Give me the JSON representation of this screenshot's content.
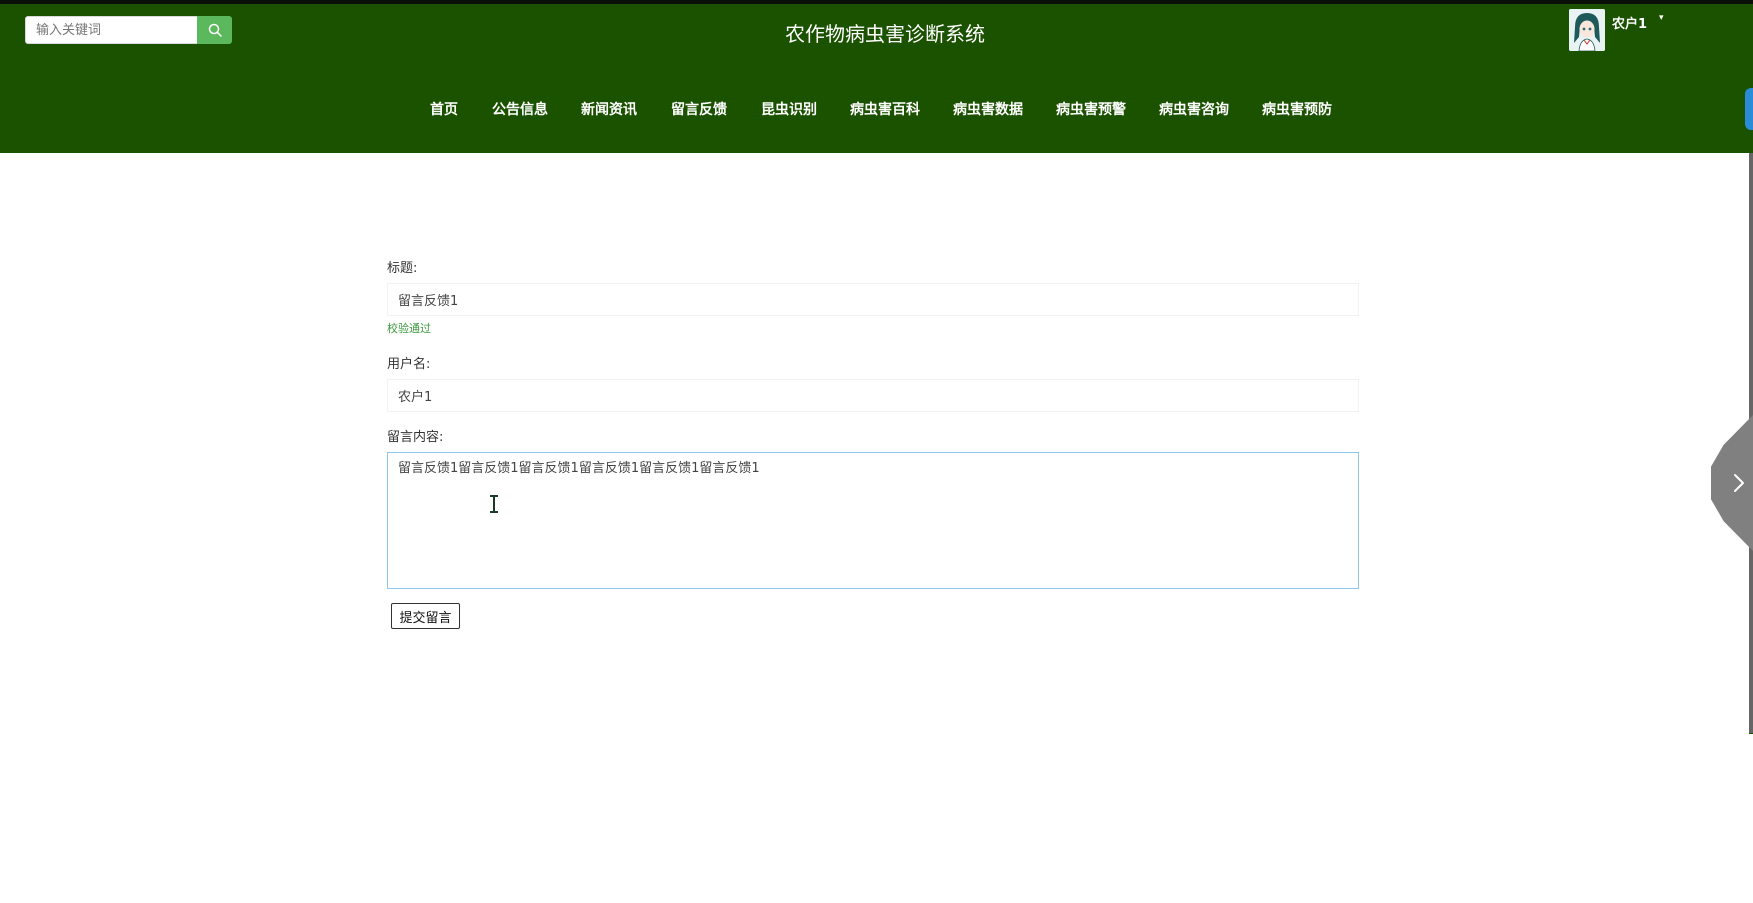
{
  "header": {
    "title": "农作物病虫害诊断系统",
    "search": {
      "placeholder": "输入关键词",
      "icon": "search-icon"
    },
    "user": {
      "name": "农户1",
      "caret": "▾"
    }
  },
  "nav": {
    "items": [
      {
        "label": "首页"
      },
      {
        "label": "公告信息"
      },
      {
        "label": "新闻资讯"
      },
      {
        "label": "留言反馈"
      },
      {
        "label": "昆虫识别"
      },
      {
        "label": "病虫害百科"
      },
      {
        "label": "病虫害数据"
      },
      {
        "label": "病虫害预警"
      },
      {
        "label": "病虫害咨询"
      },
      {
        "label": "病虫害预防"
      }
    ]
  },
  "form": {
    "title_label": "标题:",
    "title_value": "留言反馈1",
    "title_validation": "校验通过",
    "username_label": "用户名:",
    "username_value": "农户1",
    "content_label": "留言内容:",
    "content_value": "留言反馈1留言反馈1留言反馈1留言反馈1留言反馈1留言反馈1",
    "submit_label": "提交留言"
  },
  "side_toggle": {
    "icon": "chevron-right-icon"
  },
  "colors": {
    "header_bg": "#1a5200",
    "search_button": "#5cb85c",
    "validation_text": "#3c9b3c",
    "textarea_focus_border": "#8cc8ec"
  }
}
